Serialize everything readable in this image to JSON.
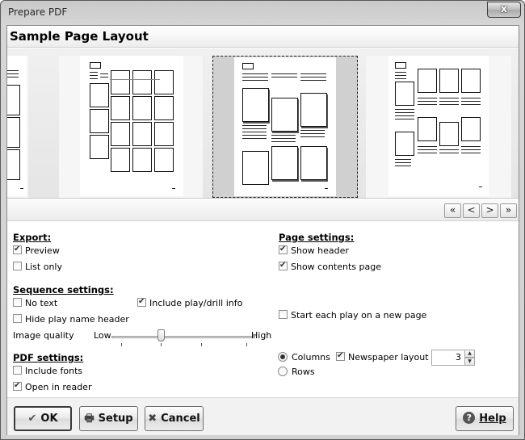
{
  "window": {
    "title": "Prepare PDF",
    "close_glyph": "x"
  },
  "header": {
    "title": "Sample Page Layout"
  },
  "pager": {
    "first": "«",
    "prev": "<",
    "next": ">",
    "last": "»"
  },
  "export": {
    "title": "Export:",
    "preview": {
      "label": "Preview",
      "checked": true
    },
    "list_only": {
      "label": "List only",
      "checked": false
    }
  },
  "page_settings": {
    "title": "Page settings:",
    "show_header": {
      "label": "Show header",
      "checked": true
    },
    "show_contents_page": {
      "label": "Show contents page",
      "checked": true
    }
  },
  "sequence_settings": {
    "title": "Sequence settings:",
    "no_text": {
      "label": "No text",
      "checked": false
    },
    "include_play_drill_info": {
      "label": "Include play/drill info",
      "checked": true
    },
    "hide_play_name_header": {
      "label": "Hide play name header",
      "checked": false
    },
    "start_each_play_new_page": {
      "label": "Start each play on a new page",
      "checked": false
    },
    "image_quality": {
      "label": "Image quality",
      "low": "Low",
      "high": "High",
      "value_fraction": 0.3
    }
  },
  "pdf_settings": {
    "title": "PDF settings:",
    "include_fonts": {
      "label": "Include fonts",
      "checked": false
    },
    "open_in_reader": {
      "label": "Open in reader",
      "checked": true
    }
  },
  "layout": {
    "columns": {
      "label": "Columns",
      "selected": true
    },
    "rows": {
      "label": "Rows",
      "selected": false
    },
    "newspaper_layout": {
      "label": "Newspaper layout",
      "checked": true
    },
    "count": "3"
  },
  "buttons": {
    "ok": {
      "label": "OK",
      "icon": "checkmark-icon"
    },
    "setup": {
      "label": "Setup",
      "icon": "printer-icon"
    },
    "cancel": {
      "label": "Cancel",
      "icon": "cancel-x-icon"
    },
    "help": {
      "label": "Help",
      "icon": "help-icon"
    }
  }
}
